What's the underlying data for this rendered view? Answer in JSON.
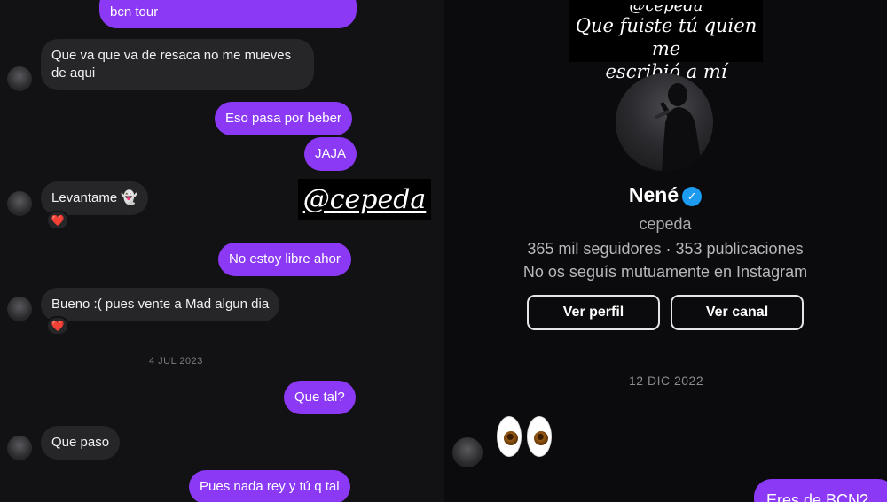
{
  "left_chat": {
    "messages": [
      {
        "side": "out",
        "text": "bcn tour"
      },
      {
        "side": "in",
        "text": "Que va que va de resaca no me mueves de aqui"
      },
      {
        "side": "out",
        "text": "Eso pasa por beber"
      },
      {
        "side": "out",
        "text": "JAJA"
      },
      {
        "side": "in",
        "text": "Levantame 👻"
      },
      {
        "side": "out",
        "text": "No estoy libre ahor"
      },
      {
        "side": "in",
        "text": "Bueno :( pues vente a Mad algun dia"
      },
      {
        "side": "out",
        "text": "Que tal?"
      },
      {
        "side": "in",
        "text": "Que paso"
      },
      {
        "side": "out",
        "text": "Pues nada rey y tú q tal"
      }
    ],
    "date_separator": "4 JUL 2023",
    "reaction": "❤️"
  },
  "stickers": {
    "mention": "@cepeda",
    "quote_top": "@cepeda",
    "quote_line1": "Que fuiste tú quien me",
    "quote_line2": "escribió a mí"
  },
  "profile": {
    "name": "Nené",
    "verified_icon": "✓",
    "username": "cepeda",
    "stats": "365 mil seguidores · 353 publicaciones",
    "mutual": "No os seguís mutuamente en Instagram",
    "view_profile_label": "Ver perfil",
    "view_channel_label": "Ver canal"
  },
  "right_chat": {
    "date_separator": "12 DIC 2022",
    "sticker": "👀",
    "last_message": "Eres de BCN?"
  },
  "colors": {
    "outgoing_bubble": "#8b39f5",
    "incoming_bubble": "#262629",
    "background": "#121214",
    "verified": "#1d9bf0"
  }
}
